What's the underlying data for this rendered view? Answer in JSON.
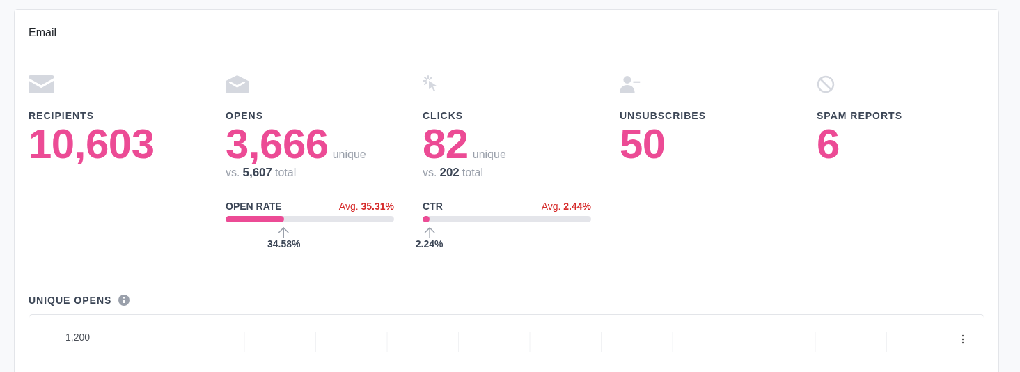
{
  "card": {
    "title": "Email"
  },
  "metrics": [
    {
      "kind": "plain",
      "label": "RECIPIENTS",
      "value": "10,603"
    },
    {
      "kind": "rate",
      "label": "OPENS",
      "value": "3,666",
      "unit": "unique",
      "vs": "vs.",
      "total": "5,607",
      "total_unit": "total",
      "rate": {
        "label": "OPEN RATE",
        "avg_label": "Avg.",
        "avg": "35.31%",
        "level": 0.3458,
        "reading": "34.58%"
      }
    },
    {
      "kind": "rate",
      "label": "CLICKS",
      "value": "82",
      "unit": "unique",
      "vs": "vs.",
      "total": "202",
      "total_unit": "total",
      "rate": {
        "label": "CTR",
        "avg_label": "Avg.",
        "avg": "2.44%",
        "level": 0.0224,
        "reading": "2.24%"
      }
    },
    {
      "kind": "plain",
      "label": "UNSUBSCRIBES",
      "value": "50"
    },
    {
      "kind": "plain",
      "label": "SPAM REPORTS",
      "value": "6"
    }
  ],
  "chart_section": {
    "title": "UNIQUE OPENS",
    "y_tick": "1,200"
  }
}
